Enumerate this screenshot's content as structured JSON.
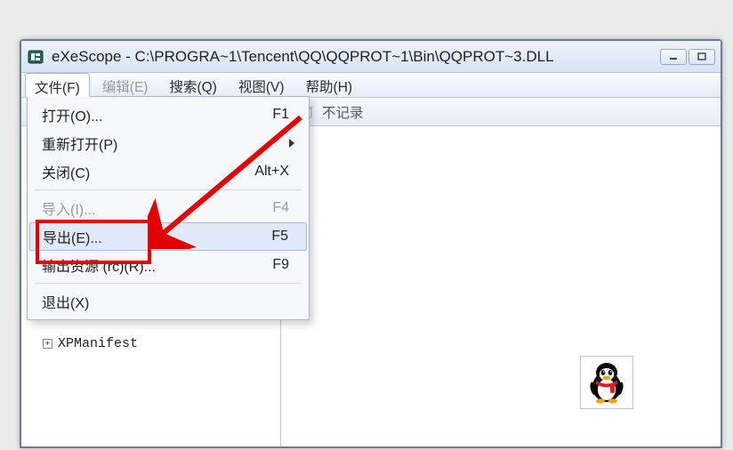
{
  "window": {
    "title": "eXeScope - C:\\PROGRA~1\\Tencent\\QQ\\QQPROT~1\\Bin\\QQPROT~3.DLL"
  },
  "menubar": {
    "file": "文件(F)",
    "edit": "编辑(E)",
    "search": "搜索(Q)",
    "view": "视图(V)",
    "help": "帮助(H)"
  },
  "toolbar": {
    "no_log_label": "不记录"
  },
  "dropdown": {
    "open": {
      "label": "打开(O)...",
      "shortcut": "F1"
    },
    "reopen": {
      "label": "重新打开(P)"
    },
    "close": {
      "label": "关闭(C)",
      "shortcut": "Alt+X"
    },
    "import": {
      "label": "导入(I)...",
      "shortcut": "F4"
    },
    "export": {
      "label": "导出(E)...",
      "shortcut": "F5"
    },
    "output_resource": {
      "label": "输出资源 (rc)(R)...",
      "shortcut": "F9"
    },
    "exit": {
      "label": "退出(X)"
    }
  },
  "tree": {
    "node_xpmanifest": "XPManifest"
  }
}
